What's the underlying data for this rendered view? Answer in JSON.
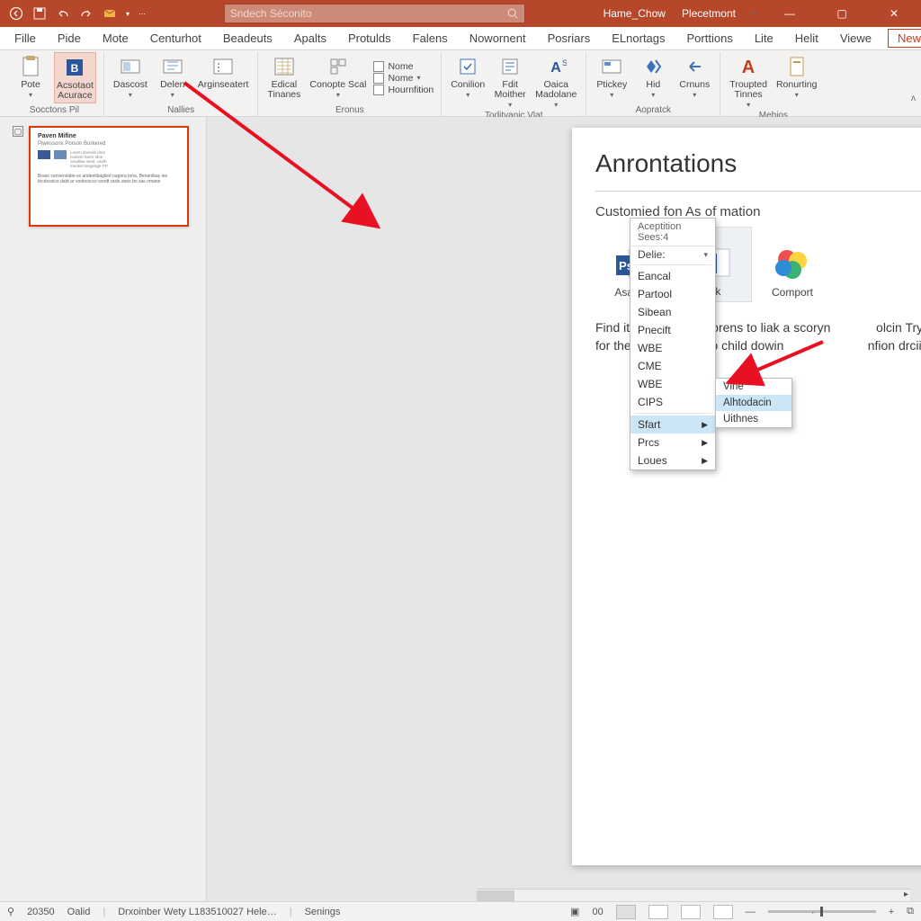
{
  "titlebar": {
    "search_placeholder": "Sndech Séconito",
    "right": {
      "home": "Hame_Chow",
      "place": "Plecetmont"
    }
  },
  "tabs": {
    "items": [
      "Fille",
      "Pide",
      "Mote",
      "Centurhot",
      "Beadeuts",
      "Apalts",
      "Protulds",
      "Falens",
      "Nowornent",
      "Posriars",
      "ELnortags",
      "Porttions",
      "Lite",
      "Helit",
      "Viewe"
    ],
    "new": "New"
  },
  "ribbon": {
    "g1": {
      "b1": "Pote",
      "b2_l1": "Acsotaot",
      "b2_l2": "Acurace",
      "label": "Socctons Pil"
    },
    "g2": {
      "b1": "Dascost",
      "b2": "Delen",
      "b3": "Arginseatert",
      "label": "Nallies"
    },
    "g3": {
      "b1_l1": "Edical",
      "b1_l2": "Tinanes",
      "b2": "Conopte Scal",
      "s1": "Nome",
      "s2": "Nome",
      "s3": "Hournfition",
      "label": "Eronus"
    },
    "g4": {
      "b1": "Conilion",
      "b2_l1": "Fdit",
      "b2_l2": "Moither",
      "b3_l1": "Oaica",
      "b3_l2": "Madolane",
      "label": "Toditvanic Vlat"
    },
    "g5": {
      "b1": "Ptickey",
      "b2": "Hid",
      "b3": "Crnuns",
      "label": "Aopratck"
    },
    "g6": {
      "b1_l1": "Troupted",
      "b1_l2": "Tinnes",
      "b2": "Ronurting",
      "label": "Mebios"
    }
  },
  "thumb": {
    "title": "Paven Mifine",
    "sub": "Piwessonx Porson Borkered",
    "p": "Braxe cenverstatle-ss andeelibaglied nagera tona, Benanibay ies tecdessice dabt ar vodenscce wordt rasls anes bo sas omane"
  },
  "page": {
    "title": "Anrontations",
    "sub": "Customied fon As of mation",
    "cards": {
      "a": "Asaryes",
      "b": "Blk",
      "c": "Comport"
    },
    "body": "Find it and dis to nosprens to liak a scoryn             olcin Try yont to tinat ing for the obleo rease, to child dowin                        nfion drciibe agd yor opded."
  },
  "ctx": {
    "header": "Aceptition Sees:4",
    "delle": "Delie:",
    "items": [
      "Eancal",
      "Partool",
      "Sibean",
      "Pnecift",
      "WBE",
      "CME",
      "WBE",
      "CIPS"
    ],
    "sfart": "Sfart",
    "prcs": "Prcs",
    "loues": "Loues"
  },
  "submenu": {
    "a": "Vine",
    "b": "Alhtodacin",
    "c": "Uithnes"
  },
  "status": {
    "left1": "20350",
    "left2": "Oalid",
    "left3": "Drxoinber Wety L183510027 Hele…",
    "left4": "Senings",
    "page": "00"
  }
}
